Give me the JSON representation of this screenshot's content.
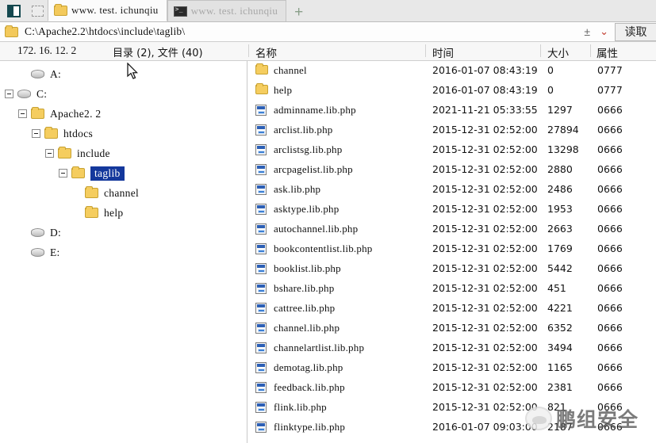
{
  "tabbar": {
    "window_button": "window-restore",
    "select_button": "marquee-select",
    "tabs": [
      {
        "label": "www. test. ichunqiu",
        "icon": "folder-icon",
        "active": true
      },
      {
        "label": "www. test. ichunqiu",
        "icon": "terminal-icon",
        "active": false
      }
    ],
    "new_tab": "+"
  },
  "pathbar": {
    "folder_icon": "folder-icon",
    "path": "C:\\Apache2.2\\htdocs\\include\\taglib\\",
    "plusminus_icon": "±",
    "chevron_icon": "⌄",
    "read_button": "读取"
  },
  "columns": {
    "ip": "172. 16. 12. 2",
    "counts": "目录 (2), 文件 (40)",
    "name": "名称",
    "time": "时间",
    "size": "大小",
    "attr": "属性"
  },
  "tree": [
    {
      "label": "A:",
      "icon": "drive-icon",
      "indent": 1,
      "toggle": "none",
      "selected": false
    },
    {
      "label": "C:",
      "icon": "drive-icon",
      "indent": 0,
      "toggle": "minus",
      "selected": false
    },
    {
      "label": "Apache2. 2",
      "icon": "folder-icon",
      "indent": 1,
      "toggle": "minus",
      "selected": false
    },
    {
      "label": "htdocs",
      "icon": "folder-icon",
      "indent": 2,
      "toggle": "minus",
      "selected": false
    },
    {
      "label": "include",
      "icon": "folder-icon",
      "indent": 3,
      "toggle": "minus",
      "selected": false
    },
    {
      "label": "taglib",
      "icon": "folder-icon",
      "indent": 4,
      "toggle": "minus",
      "selected": true
    },
    {
      "label": "channel",
      "icon": "folder-icon",
      "indent": 5,
      "toggle": "none",
      "selected": false
    },
    {
      "label": "help",
      "icon": "folder-icon",
      "indent": 5,
      "toggle": "none",
      "selected": false
    },
    {
      "label": "D:",
      "icon": "drive-icon",
      "indent": 1,
      "toggle": "none",
      "selected": false
    },
    {
      "label": "E:",
      "icon": "drive-icon",
      "indent": 1,
      "toggle": "none",
      "selected": false
    }
  ],
  "files": [
    {
      "name": "channel",
      "icon": "folder-icon",
      "date": "2016-01-07",
      "time": "08:43:19",
      "size": "0",
      "attr": "0777"
    },
    {
      "name": "help",
      "icon": "folder-icon",
      "date": "2016-01-07",
      "time": "08:43:19",
      "size": "0",
      "attr": "0777"
    },
    {
      "name": "adminname.lib.php",
      "icon": "php-file-icon",
      "date": "2021-11-21",
      "time": "05:33:55",
      "size": "1297",
      "attr": "0666"
    },
    {
      "name": "arclist.lib.php",
      "icon": "php-file-icon",
      "date": "2015-12-31",
      "time": "02:52:00",
      "size": "27894",
      "attr": "0666"
    },
    {
      "name": "arclistsg.lib.php",
      "icon": "php-file-icon",
      "date": "2015-12-31",
      "time": "02:52:00",
      "size": "13298",
      "attr": "0666"
    },
    {
      "name": "arcpagelist.lib.php",
      "icon": "php-file-icon",
      "date": "2015-12-31",
      "time": "02:52:00",
      "size": "2880",
      "attr": "0666"
    },
    {
      "name": "ask.lib.php",
      "icon": "php-file-icon",
      "date": "2015-12-31",
      "time": "02:52:00",
      "size": "2486",
      "attr": "0666"
    },
    {
      "name": "asktype.lib.php",
      "icon": "php-file-icon",
      "date": "2015-12-31",
      "time": "02:52:00",
      "size": "1953",
      "attr": "0666"
    },
    {
      "name": "autochannel.lib.php",
      "icon": "php-file-icon",
      "date": "2015-12-31",
      "time": "02:52:00",
      "size": "2663",
      "attr": "0666"
    },
    {
      "name": "bookcontentlist.lib.php",
      "icon": "php-file-icon",
      "date": "2015-12-31",
      "time": "02:52:00",
      "size": "1769",
      "attr": "0666"
    },
    {
      "name": "booklist.lib.php",
      "icon": "php-file-icon",
      "date": "2015-12-31",
      "time": "02:52:00",
      "size": "5442",
      "attr": "0666"
    },
    {
      "name": "bshare.lib.php",
      "icon": "php-file-icon",
      "date": "2015-12-31",
      "time": "02:52:00",
      "size": "451",
      "attr": "0666"
    },
    {
      "name": "cattree.lib.php",
      "icon": "php-file-icon",
      "date": "2015-12-31",
      "time": "02:52:00",
      "size": "4221",
      "attr": "0666"
    },
    {
      "name": "channel.lib.php",
      "icon": "php-file-icon",
      "date": "2015-12-31",
      "time": "02:52:00",
      "size": "6352",
      "attr": "0666"
    },
    {
      "name": "channelartlist.lib.php",
      "icon": "php-file-icon",
      "date": "2015-12-31",
      "time": "02:52:00",
      "size": "3494",
      "attr": "0666"
    },
    {
      "name": "demotag.lib.php",
      "icon": "php-file-icon",
      "date": "2015-12-31",
      "time": "02:52:00",
      "size": "1165",
      "attr": "0666"
    },
    {
      "name": "feedback.lib.php",
      "icon": "php-file-icon",
      "date": "2015-12-31",
      "time": "02:52:00",
      "size": "2381",
      "attr": "0666"
    },
    {
      "name": "flink.lib.php",
      "icon": "php-file-icon",
      "date": "2015-12-31",
      "time": "02:52:00",
      "size": "821",
      "attr": "0666"
    },
    {
      "name": "flinktype.lib.php",
      "icon": "php-file-icon",
      "date": "2016-01-07",
      "time": "09:03:00",
      "size": "2187",
      "attr": "0666"
    }
  ],
  "watermark": {
    "text": "鹏组安全",
    "logo": "pig-logo-icon"
  },
  "cursor": "mouse-pointer"
}
